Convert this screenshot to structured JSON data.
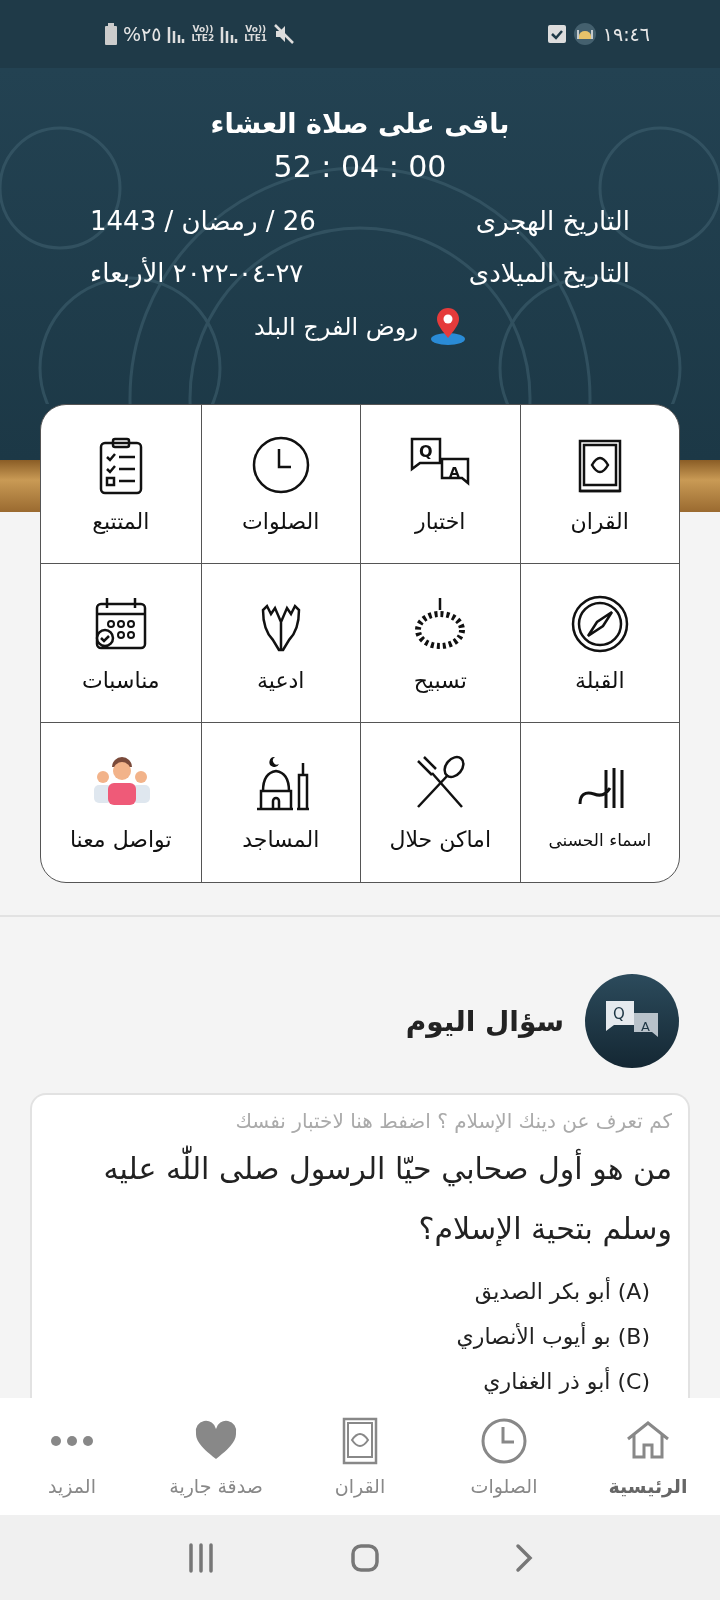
{
  "status_bar": {
    "time": "١٩:٤٦",
    "battery": "%٢٥",
    "sim_2": {
      "volte": "Vo))",
      "network": "LTE2"
    },
    "sim_1": {
      "volte": "Vo))",
      "network": "LTE1"
    }
  },
  "header": {
    "next_prayer": "باقى على صلاة العشاء",
    "countdown": "52 : 04 : 00",
    "dates": [
      {
        "label": "التاريخ  الهجرى",
        "value": "26 / رمضان / 1443"
      },
      {
        "label": "التاريخ الميلادى",
        "value": "٢٧-٠٤-٢٠٢٢ الأربعاء"
      }
    ],
    "location": "روض الفرج البلد"
  },
  "features": [
    {
      "label": "القران"
    },
    {
      "label": "اختبار",
      "icon_text": [
        "Q",
        "A"
      ]
    },
    {
      "label": "الصلوات"
    },
    {
      "label": "المتتبع"
    },
    {
      "label": "القبلة"
    },
    {
      "label": "تسبيح"
    },
    {
      "label": "ادعية"
    },
    {
      "label": "مناسبات"
    },
    {
      "label": "اسماء الحسنى"
    },
    {
      "label": "اماكن حلال"
    },
    {
      "label": "المساجد"
    },
    {
      "label": "تواصل معنا"
    }
  ],
  "daily_question": {
    "icon_text": [
      "Q",
      "A"
    ],
    "title": "سؤال اليوم",
    "hint": "كم تعرف عن دينك الإسلام ؟ اضفط هنا لاختبار نفسك",
    "question": "من هو أول صحابي حيّا الرسول صلى اللّٰه عليه وسلم بتحية الإسلام؟",
    "options": [
      "(A) أبو بكر الصديق",
      "(B) بو أيوب الأنصاري",
      "(C) أبو ذر الغفاري"
    ]
  },
  "bottom_nav": [
    {
      "label": "الرئيسية",
      "selected": true
    },
    {
      "label": "الصلوات",
      "selected": false
    },
    {
      "label": "القران",
      "selected": false
    },
    {
      "label": "صدقة جارية",
      "selected": false
    },
    {
      "label": "المزيد",
      "selected": false
    }
  ]
}
